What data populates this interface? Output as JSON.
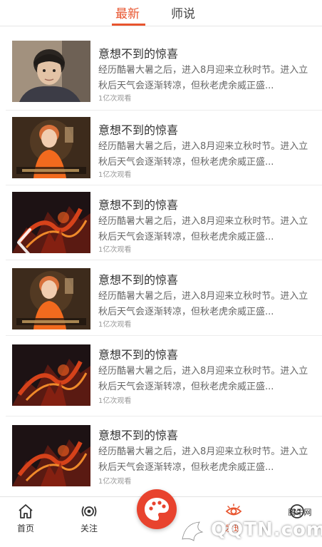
{
  "tabs": [
    {
      "label": "最新",
      "active": true
    },
    {
      "label": "师说",
      "active": false
    }
  ],
  "feed": {
    "items": [
      {
        "title": "意想不到的惊喜",
        "desc_line1": "经历酷暑大暑之后，进入8月迎来立秋时节。进入立",
        "desc_line2": "秋后天气会逐渐转凉，但秋老虎余威正盛...",
        "views": "1亿次观看",
        "thumb": "portrait-photo"
      },
      {
        "title": "意想不到的惊喜",
        "desc_line1": "经历酷暑大暑之后，进入8月迎来立秋时节。进入立",
        "desc_line2": "秋后天气会逐渐转凉，但秋老虎余威正盛...",
        "views": "1亿次观看",
        "thumb": "singer-poster"
      },
      {
        "title": "意想不到的惊喜",
        "desc_line1": "经历酷暑大暑之后，进入8月迎来立秋时节。进入立",
        "desc_line2": "秋后天气会逐渐转凉，但秋老虎余威正盛...",
        "views": "1亿次观看",
        "thumb": "dragon-art"
      },
      {
        "title": "意想不到的惊喜",
        "desc_line1": "经历酷暑大暑之后，进入8月迎来立秋时节。进入立",
        "desc_line2": "秋后天气会逐渐转凉，但秋老虎余威正盛...",
        "views": "1亿次观看",
        "thumb": "singer-poster"
      },
      {
        "title": "意想不到的惊喜",
        "desc_line1": "经历酷暑大暑之后，进入8月迎来立秋时节。进入立",
        "desc_line2": "秋后天气会逐渐转凉，但秋老虎余威正盛...",
        "views": "1亿次观看",
        "thumb": "dragon-art"
      },
      {
        "title": "意想不到的惊喜",
        "desc_line1": "经历酷暑大暑之后，进入8月迎来立秋时节。进入立",
        "desc_line2": "秋后天气会逐渐转凉，但秋老虎余威正盛...",
        "views": "1亿次观看",
        "thumb": "dragon-art"
      }
    ]
  },
  "bottom_nav": {
    "home_label": "首页",
    "follow_label": "关注",
    "discover_label": "发现",
    "center_icon": "palette-icon"
  },
  "watermark": {
    "text": "QQTN.com",
    "badge": "腾牛网"
  },
  "colors": {
    "accent": "#e8542e",
    "fab": "#e8432e",
    "text": "#333333",
    "subtext": "#666666",
    "muted": "#999999"
  }
}
